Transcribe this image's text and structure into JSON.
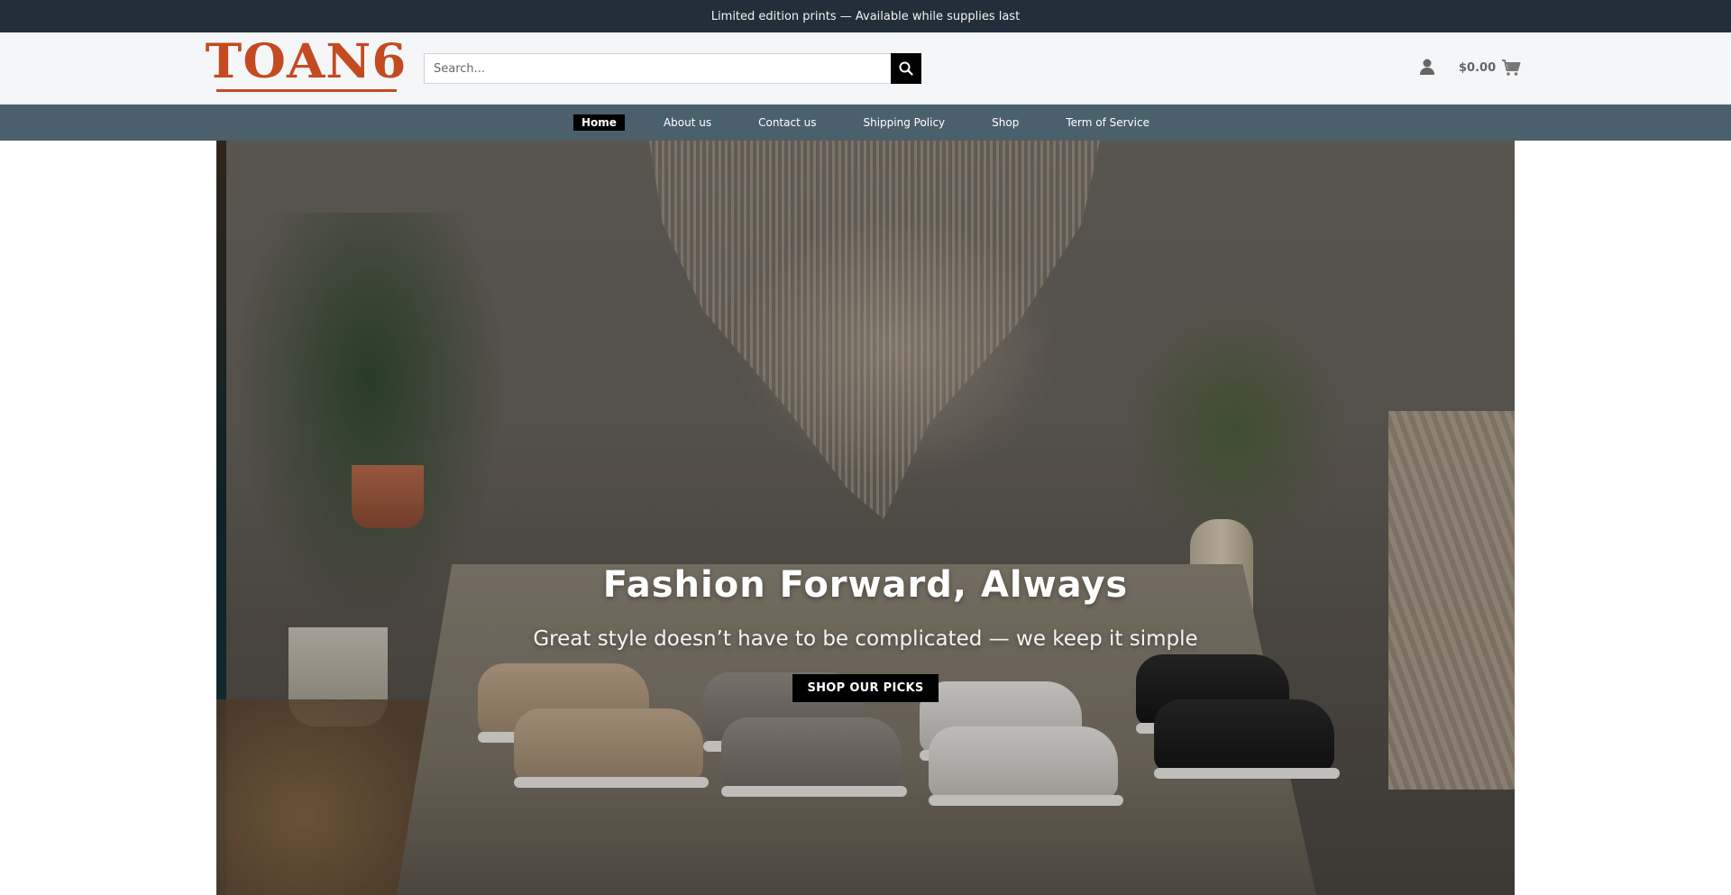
{
  "announcement": {
    "text": "Limited edition prints — Available while supplies last"
  },
  "header": {
    "logo_text": "TOAN6",
    "search": {
      "placeholder": "Search...",
      "value": ""
    },
    "cart_total": "$0.00",
    "icons": {
      "search": "search-icon",
      "account": "user-icon",
      "cart": "cart-icon"
    }
  },
  "nav": {
    "items": [
      {
        "label": "Home",
        "active": true
      },
      {
        "label": "About us",
        "active": false
      },
      {
        "label": "Contact us",
        "active": false
      },
      {
        "label": "Shipping Policy",
        "active": false
      },
      {
        "label": "Shop",
        "active": false
      },
      {
        "label": "Term of Service",
        "active": false
      }
    ]
  },
  "hero": {
    "title": "Fashion Forward, Always",
    "subtitle": "Great style doesn’t have to be complicated — we keep it simple",
    "cta_label": "SHOP OUR PICKS"
  },
  "colors": {
    "topbar_bg": "#222f3a",
    "header_bg": "#f4f6f8",
    "nav_bg": "#4a606c",
    "logo": "#c44a22",
    "button_bg": "#000000"
  }
}
